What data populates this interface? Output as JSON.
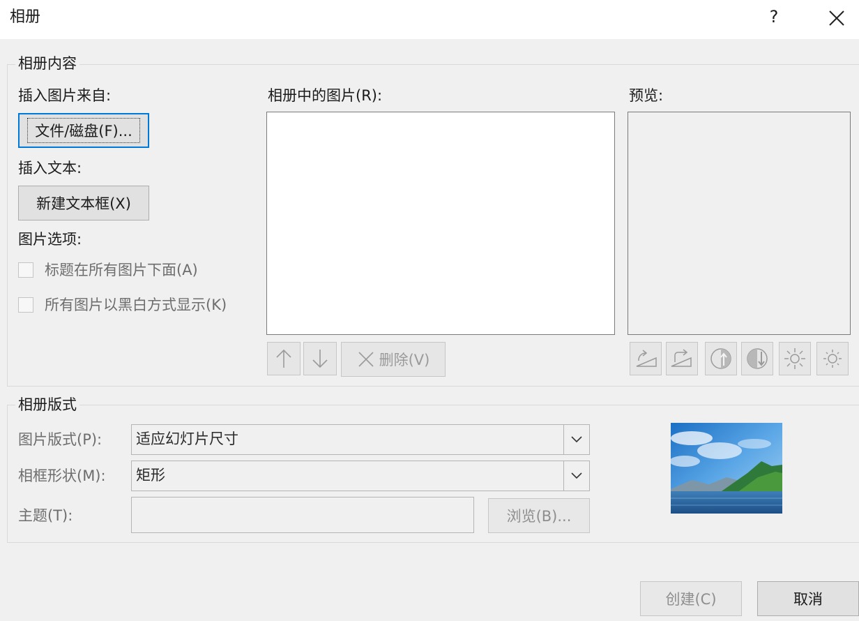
{
  "window": {
    "title": "相册",
    "help": "?"
  },
  "content_group": {
    "legend": "相册内容",
    "insert_picture_from": "插入图片来自:",
    "file_disk_button": "文件/磁盘(F)...",
    "insert_text": "插入文本:",
    "new_textbox_button": "新建文本框(X)",
    "picture_options": "图片选项:",
    "options": [
      {
        "label": "标题在所有图片下面(A)",
        "checked": false
      },
      {
        "label": "所有图片以黑白方式显示(K)",
        "checked": false
      }
    ],
    "pictures_in_album": "相册中的图片(R):",
    "delete_button": "删除(V)",
    "preview_label": "预览:"
  },
  "layout_group": {
    "legend": "相册版式",
    "picture_layout_label": "图片版式(P):",
    "picture_layout_value": "适应幻灯片尺寸",
    "frame_shape_label": "相框形状(M):",
    "frame_shape_value": "矩形",
    "theme_label": "主题(T):",
    "theme_value": "",
    "browse_button": "浏览(B)..."
  },
  "footer": {
    "create_button": "创建(C)",
    "cancel_button": "取消"
  },
  "icons": {
    "move_up": "arrow-up-icon",
    "move_down": "arrow-down-icon",
    "delete": "x-icon",
    "rotate_left": "rotate-left-icon",
    "rotate_right": "rotate-right-icon",
    "contrast_up": "contrast-up-icon",
    "contrast_down": "contrast-down-icon",
    "brightness_up": "brightness-up-icon",
    "brightness_down": "brightness-down-icon"
  },
  "colors": {
    "focus": "#0078d7",
    "dialog_bg": "#f0f0f0",
    "titlebar_bg": "#ffffff"
  }
}
